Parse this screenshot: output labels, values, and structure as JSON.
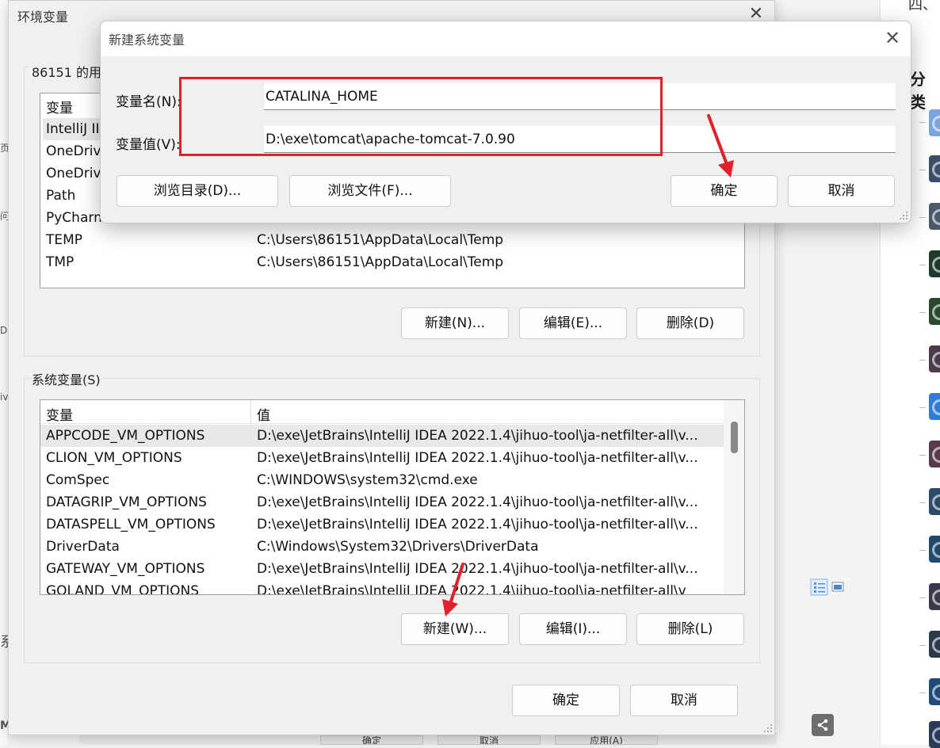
{
  "background": {
    "top_right_text": "四、",
    "category_text": "分类",
    "left_glyphs": [
      "页",
      "问",
      "D",
      "iv",
      "系",
      "M"
    ],
    "bottom_buttons": [
      "确定",
      "取消",
      "应用(A)"
    ],
    "thumb_colors": [
      "#7aa6e0",
      "#3a4f6a",
      "#4a5a6b",
      "#1f3a2a",
      "#2a4a30",
      "#4a3a4a",
      "#2f7bd6",
      "#5a3a4a",
      "#2a4a6a",
      "#1f4a6a",
      "#3a3a4a",
      "#2a3a4a",
      "#1f4a7a",
      "#2a3a5a"
    ]
  },
  "env_dialog": {
    "title": "环境变量",
    "close_glyph": "✕",
    "user_section": {
      "label": "86151 的用",
      "header": "变量",
      "rows": [
        {
          "name": "IntelliJ II",
          "value": ""
        },
        {
          "name": "OneDriv",
          "value": ""
        },
        {
          "name": "OneDriv",
          "value": ""
        },
        {
          "name": "Path",
          "value": ""
        },
        {
          "name": "PyCharm",
          "value": ""
        },
        {
          "name": "TEMP",
          "value": "C:\\Users\\86151\\AppData\\Local\\Temp"
        },
        {
          "name": "TMP",
          "value": "C:\\Users\\86151\\AppData\\Local\\Temp"
        }
      ],
      "buttons": {
        "new": "新建(N)...",
        "edit": "编辑(E)...",
        "delete": "删除(D)"
      }
    },
    "system_section": {
      "label": "系统变量(S)",
      "headers": {
        "name": "变量",
        "value": "值"
      },
      "rows": [
        {
          "name": "APPCODE_VM_OPTIONS",
          "value": "D:\\exe\\JetBrains\\IntelliJ IDEA 2022.1.4\\jihuo-tool\\ja-netfilter-all\\v..."
        },
        {
          "name": "CLION_VM_OPTIONS",
          "value": "D:\\exe\\JetBrains\\IntelliJ IDEA 2022.1.4\\jihuo-tool\\ja-netfilter-all\\v..."
        },
        {
          "name": "ComSpec",
          "value": "C:\\WINDOWS\\system32\\cmd.exe"
        },
        {
          "name": "DATAGRIP_VM_OPTIONS",
          "value": "D:\\exe\\JetBrains\\IntelliJ IDEA 2022.1.4\\jihuo-tool\\ja-netfilter-all\\v..."
        },
        {
          "name": "DATASPELL_VM_OPTIONS",
          "value": "D:\\exe\\JetBrains\\IntelliJ IDEA 2022.1.4\\jihuo-tool\\ja-netfilter-all\\v..."
        },
        {
          "name": "DriverData",
          "value": "C:\\Windows\\System32\\Drivers\\DriverData"
        },
        {
          "name": "GATEWAY_VM_OPTIONS",
          "value": "D:\\exe\\JetBrains\\IntelliJ IDEA 2022.1.4\\jihuo-tool\\ja-netfilter-all\\v..."
        },
        {
          "name": "GOLAND_VM_OPTIONS",
          "value": "D:\\exe\\JetBrains\\IntelliJ IDEA 2022.1.4\\jihuo-tool\\ja-netfilter-all\\v"
        }
      ],
      "buttons": {
        "new": "新建(W)...",
        "edit": "编辑(I)...",
        "delete": "删除(L)"
      }
    },
    "ok": "确定",
    "cancel": "取消"
  },
  "new_var_dialog": {
    "title": "新建系统变量",
    "close_glyph": "✕",
    "name_label": "变量名(N):",
    "value_label": "变量值(V):",
    "name_value": "CATALINA_HOME",
    "value_value": "D:\\exe\\tomcat\\apache-tomcat-7.0.90",
    "browse_dir": "浏览目录(D)...",
    "browse_file": "浏览文件(F)...",
    "ok": "确定",
    "cancel": "取消"
  },
  "annotation_color": "#e0202a"
}
